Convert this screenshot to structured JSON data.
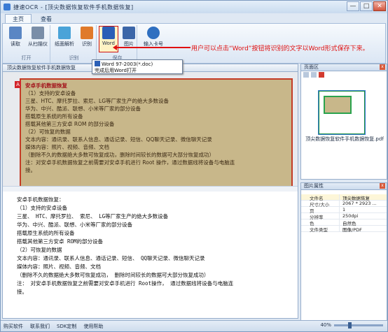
{
  "window": {
    "title": "捷速OCR - [顶尖数据恢复软件手机数据恢复]",
    "min": "—",
    "max": "□",
    "close": "✕"
  },
  "tabs": [
    "主页",
    "查看"
  ],
  "ribbon": {
    "groups": [
      {
        "name": "打开",
        "buttons": [
          "读取",
          "从扫描仪"
        ]
      },
      {
        "name": "识别",
        "buttons": [
          "纸面解析",
          "识别"
        ]
      },
      {
        "name": "保存",
        "buttons": [
          "Word",
          "图片"
        ]
      },
      {
        "name": "",
        "buttons": [
          "输入卡号"
        ]
      }
    ]
  },
  "tooltip": {
    "line1": "Word 97-2003(*.doc)",
    "line2": "完成后用Word打开"
  },
  "callout": "用户可以点击“Word”按钮将识别的文字以Word形式保存下来。",
  "doc_tab": "顶尖数据恢复软件手机数据恢复",
  "scan_lines": [
    {
      "t": "安卓手机数据恢复",
      "h": true
    },
    {
      "t": "（1）支持的安卓设备",
      "h": false
    },
    {
      "t": "    三星、HTC、摩托罗拉、索尼、LG等厂家生产的绝大多数设备",
      "h": false
    },
    {
      "t": "    华为、中兴、酷派、联想、小米等厂家的部分设备",
      "h": false
    },
    {
      "t": "    搭载原生系统的所有设备",
      "h": false
    },
    {
      "t": "    搭载其他第三方安卓 ROM 的部分设备",
      "h": false
    },
    {
      "t": "（2）可恢复的数据",
      "h": false
    },
    {
      "t": "    文本内容：通讯录、联系人信息、通话记录、短信、QQ聊天记录、微信聊天记录",
      "h": false
    },
    {
      "t": "    媒体内容：照片、视频、音频、文档",
      "h": false
    },
    {
      "t": "    （删除不久的数据绝大多数可恢复成功，删除时间较长的数据可大部分恢复成功）",
      "h": false
    },
    {
      "t": "注：对安卓手机数据恢复之前需要对安卓手机进行 Root 操作，通过数据线将设备与电脑连",
      "h": false
    },
    {
      "t": "接。",
      "h": false
    }
  ],
  "result_lines": [
    "安卓手机数据恢复：",
    "（1）支持的安卓设备",
    "  三星、 HTC、摩托罗拉、 索尼、 LG等厂家生产的绝大多数设备",
    "  华为、中兴、酷派、联想、小米等厂家的部分设备",
    "  搭载原生系统的所有设备",
    "  搭载其他第三方安卓 ROM的部分设备",
    "（2）可恢复的数据",
    "  文本内容：通讯录、联系人信息、通话记录、短信、 QQ聊天记录、微信聊天记录",
    "  媒体内容：照片、视频、音频、文档",
    "  （删除不久的数据绝大多数可恢复成功， 删除时间较长的数据可大部分恢复成功）",
    "注： 对安卓手机数据恢复之前需要对安卓手机进行 Root操作， 通过数据线将设备与电脑连",
    "接。"
  ],
  "pages_panel": {
    "title": "页面区",
    "caption": "顶尖数据恢复软件手机数据恢复.pdf"
  },
  "props_panel": {
    "title": "图片属性",
    "rows": [
      {
        "k": "文件名",
        "v": "顶尖数据恢复"
      },
      {
        "k": "尺寸/大小",
        "v": "2067 * 2923 ..."
      },
      {
        "k": "页",
        "v": "1"
      },
      {
        "k": "分辨率",
        "v": "250dpi"
      },
      {
        "k": "色",
        "v": "自然色"
      },
      {
        "k": "文件类型",
        "v": "图像/PDF"
      }
    ]
  },
  "statusbar": {
    "items": [
      "购买软件",
      "联系我们",
      "SDK定制",
      "使用帮助"
    ],
    "zoom": "40%"
  }
}
